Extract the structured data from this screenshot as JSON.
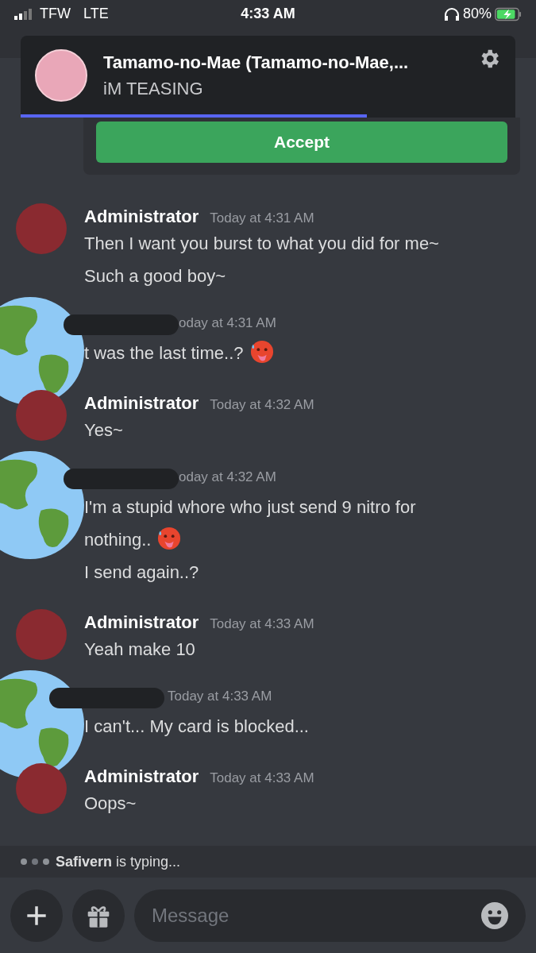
{
  "status_bar": {
    "carrier": "TFW",
    "network": "LTE",
    "time": "4:33 AM",
    "battery": "80%"
  },
  "notification": {
    "title": "Tamamo-no-Mae (Tamamo-no-Mae,...",
    "message": "iM TEASING",
    "level": 0.7
  },
  "accept_button": "Accept",
  "messages": [
    {
      "kind": "user",
      "author": "Administrator",
      "timestamp": "Today at 4:31 AM",
      "lines": [
        {
          "text": "Then I want you burst to what you did for me~"
        },
        {
          "text": "Such a good boy~"
        }
      ]
    },
    {
      "kind": "redacted",
      "timestamp": "oday at 4:31 AM",
      "lines": [
        {
          "text": "t was the last time..?",
          "emoji": true
        }
      ]
    },
    {
      "kind": "user",
      "author": "Administrator",
      "timestamp": "Today at 4:32 AM",
      "lines": [
        {
          "text": "Yes~"
        }
      ]
    },
    {
      "kind": "redacted",
      "timestamp": "oday at 4:32 AM",
      "lines": [
        {
          "text": "I'm a stupid whore who just send 9 nitro for nothing..",
          "emoji": true
        },
        {
          "text": "I send again..?"
        }
      ]
    },
    {
      "kind": "user",
      "author": "Administrator",
      "timestamp": "Today at 4:33 AM",
      "lines": [
        {
          "text": "Yeah make 10"
        }
      ]
    },
    {
      "kind": "redacted",
      "timestamp": "Today at 4:33 AM",
      "lines": [
        {
          "text": "I can't... My card is blocked..."
        }
      ]
    },
    {
      "kind": "user",
      "author": "Administrator",
      "timestamp": "Today at 4:33 AM",
      "lines": [
        {
          "text": "Oops~"
        }
      ]
    }
  ],
  "typing": {
    "user": "Safivern",
    "text": "is typing..."
  },
  "composer": {
    "placeholder": "Message"
  }
}
